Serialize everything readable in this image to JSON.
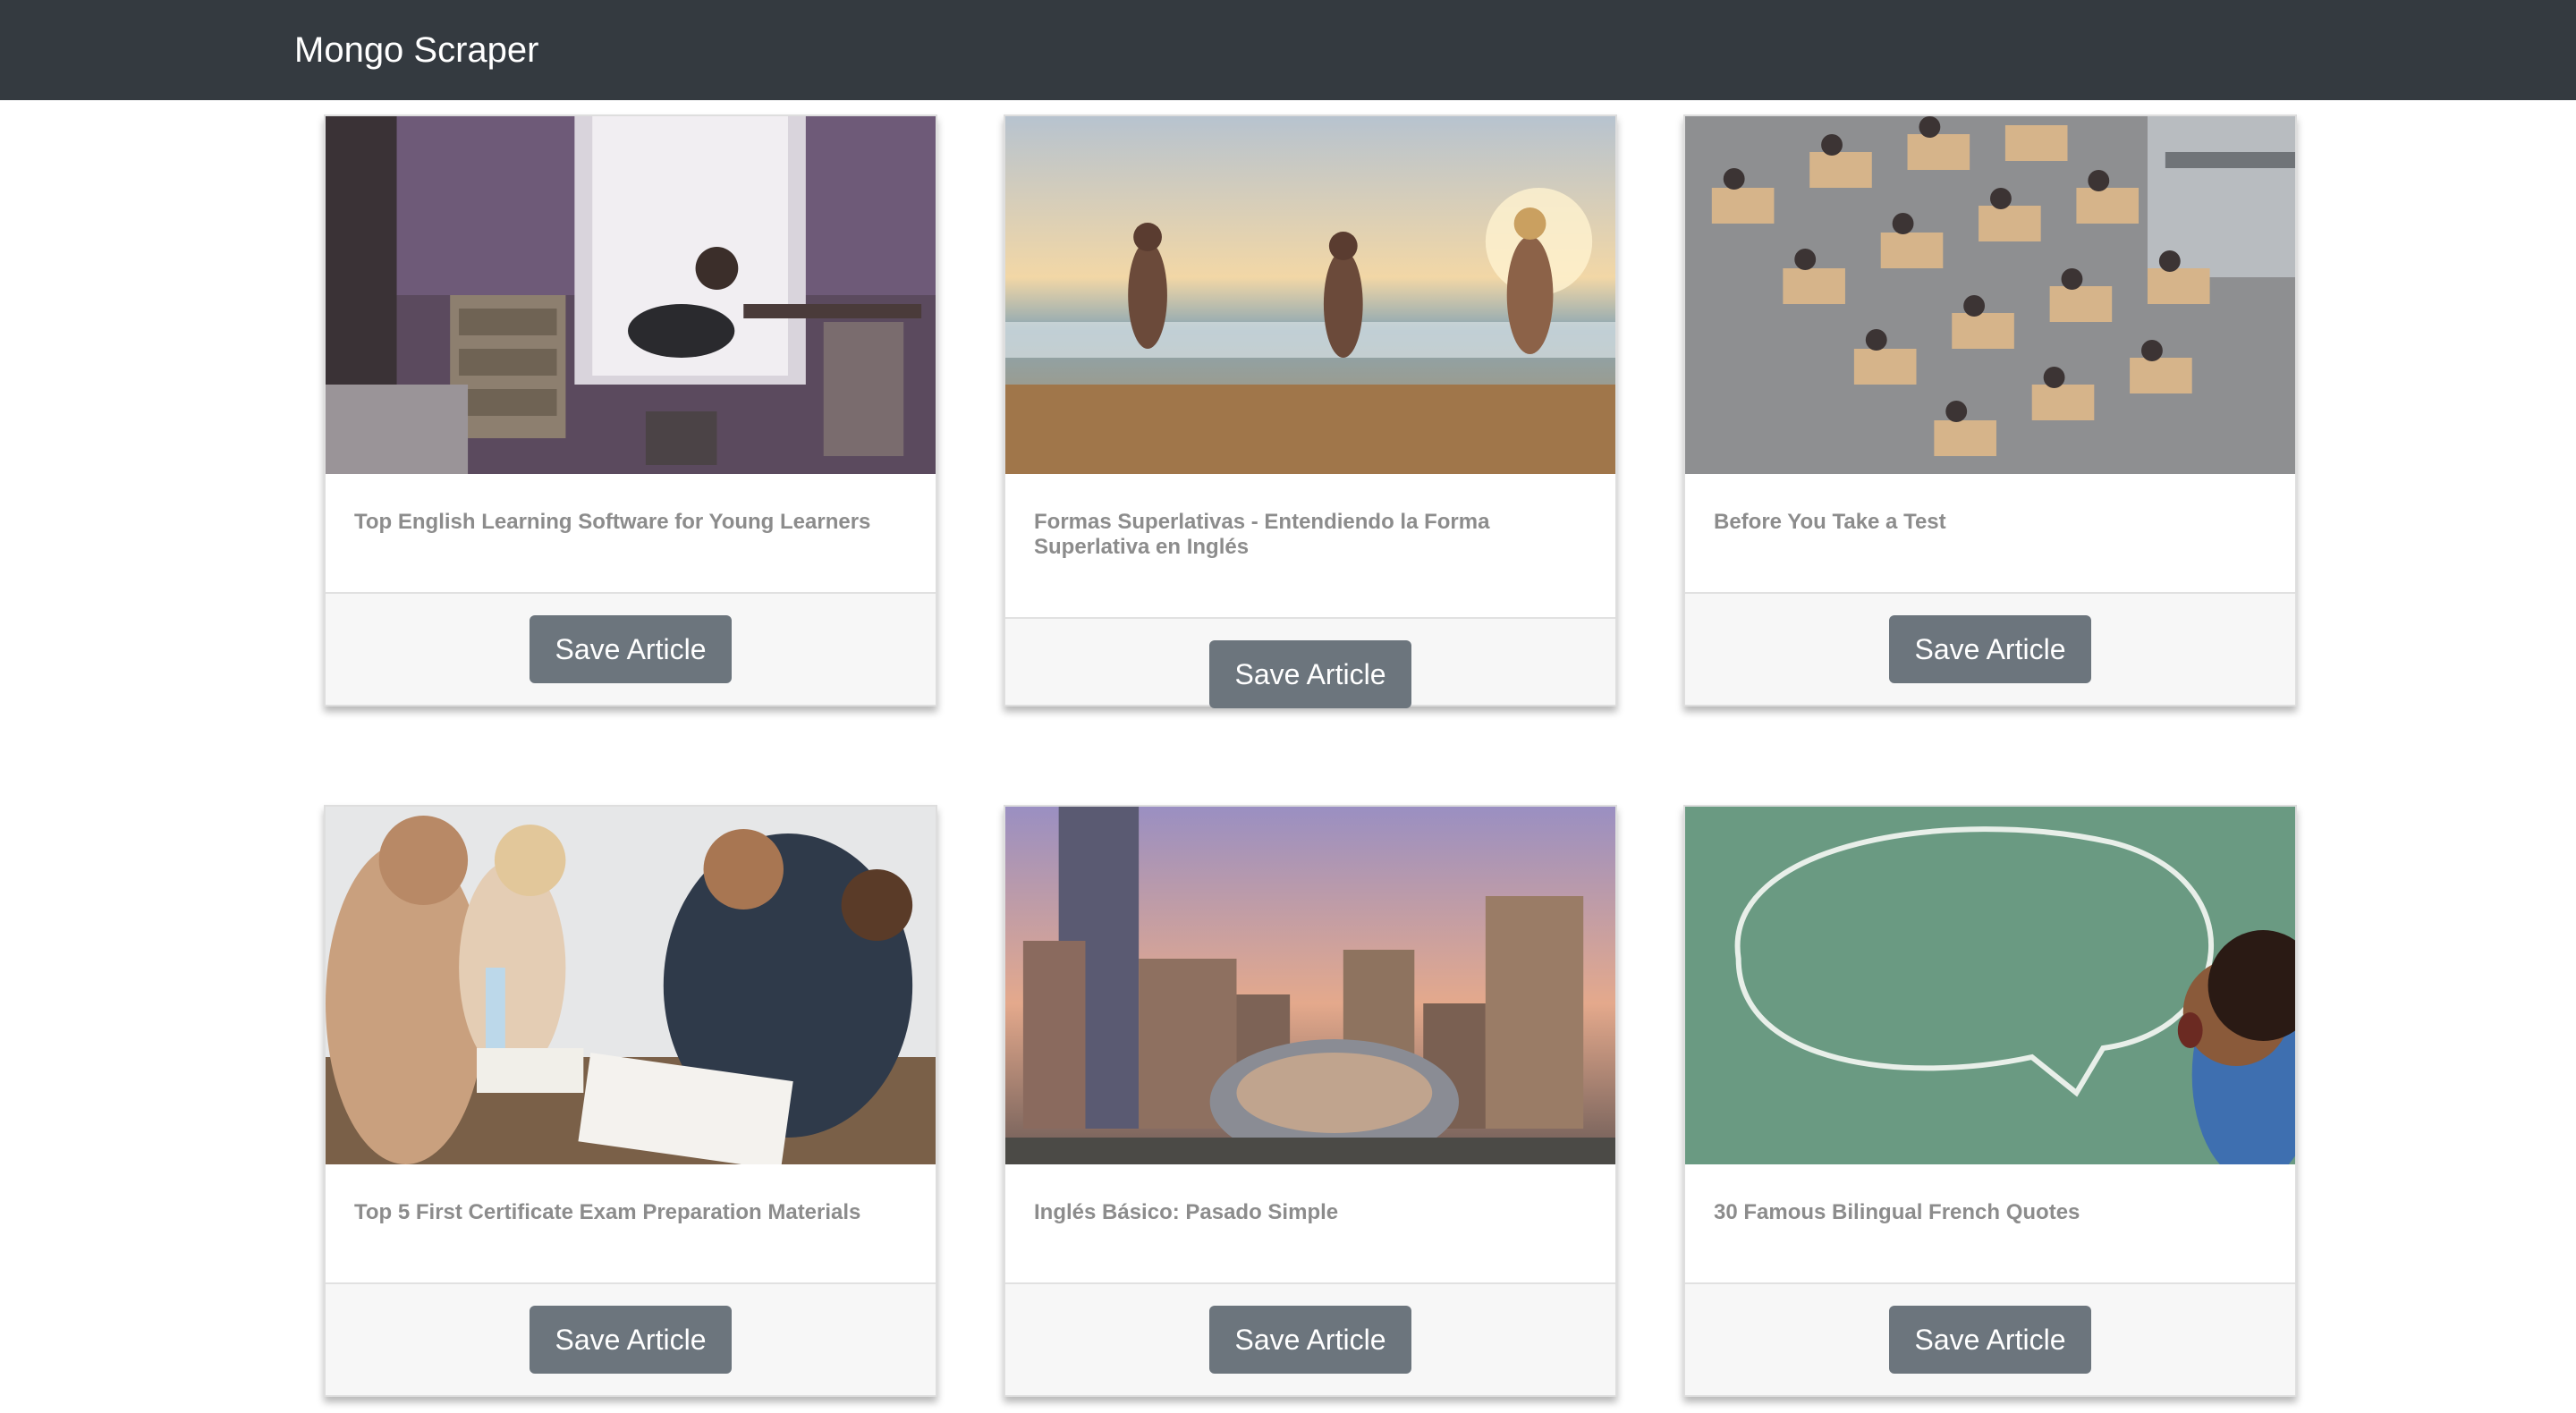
{
  "navbar": {
    "brand": "Mongo Scraper"
  },
  "articles": [
    {
      "title": "Top English Learning Software for Young Learners",
      "button": "Save Article",
      "image": "teen-girl-bedroom-laptop"
    },
    {
      "title": "Formas Superlativas - Entendiendo la Forma Superlativa en Inglés",
      "button": "Save Article",
      "image": "friends-running-beach-sunset"
    },
    {
      "title": "Before You Take a Test",
      "button": "Save Article",
      "image": "students-exam-desks-overhead"
    },
    {
      "title": "Top 5 First Certificate Exam Preparation Materials",
      "button": "Save Article",
      "image": "students-studying-books"
    },
    {
      "title": "Inglés Básico: Pasado Simple",
      "button": "Save Article",
      "image": "chicago-cloud-gate-skyline"
    },
    {
      "title": "30 Famous Bilingual French Quotes",
      "button": "Save Article",
      "image": "boy-chalkboard-speech-bubble"
    }
  ],
  "colors": {
    "navbar": "#343a40",
    "button": "#6c757d",
    "title": "#8c8c8c",
    "footer": "#f7f7f7"
  }
}
